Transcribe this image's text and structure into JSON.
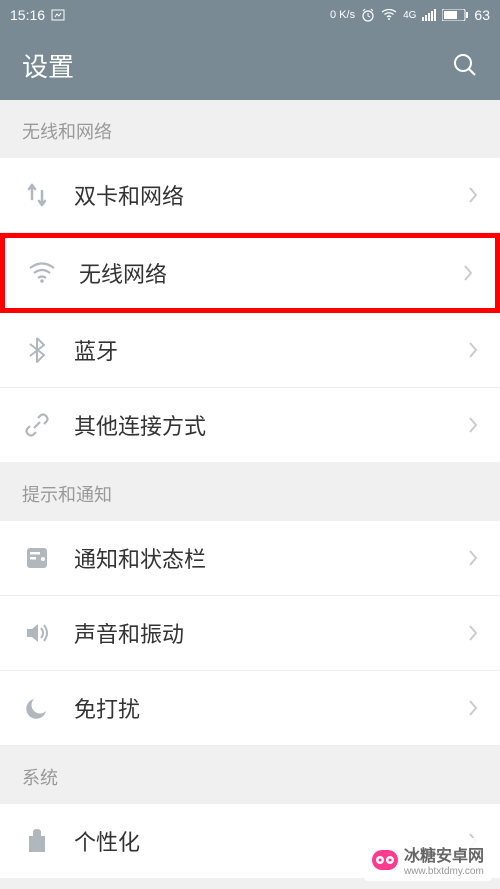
{
  "statusbar": {
    "time": "15:16",
    "speed": "0 K/s",
    "network": "4G",
    "battery": "63"
  },
  "header": {
    "title": "设置"
  },
  "sections": [
    {
      "header": "无线和网络",
      "items": [
        {
          "icon": "dual-arrows-icon",
          "label": "双卡和网络"
        },
        {
          "icon": "wifi-icon",
          "label": "无线网络",
          "highlighted": true
        },
        {
          "icon": "bluetooth-icon",
          "label": "蓝牙"
        },
        {
          "icon": "link-icon",
          "label": "其他连接方式"
        }
      ]
    },
    {
      "header": "提示和通知",
      "items": [
        {
          "icon": "notification-icon",
          "label": "通知和状态栏"
        },
        {
          "icon": "sound-icon",
          "label": "声音和振动"
        },
        {
          "icon": "dnd-icon",
          "label": "免打扰"
        }
      ]
    },
    {
      "header": "系统",
      "items": [
        {
          "icon": "theme-icon",
          "label": "个性化"
        }
      ]
    }
  ],
  "watermark": {
    "text": "冰糖安卓网",
    "url": "www.btxtdmy.com"
  }
}
